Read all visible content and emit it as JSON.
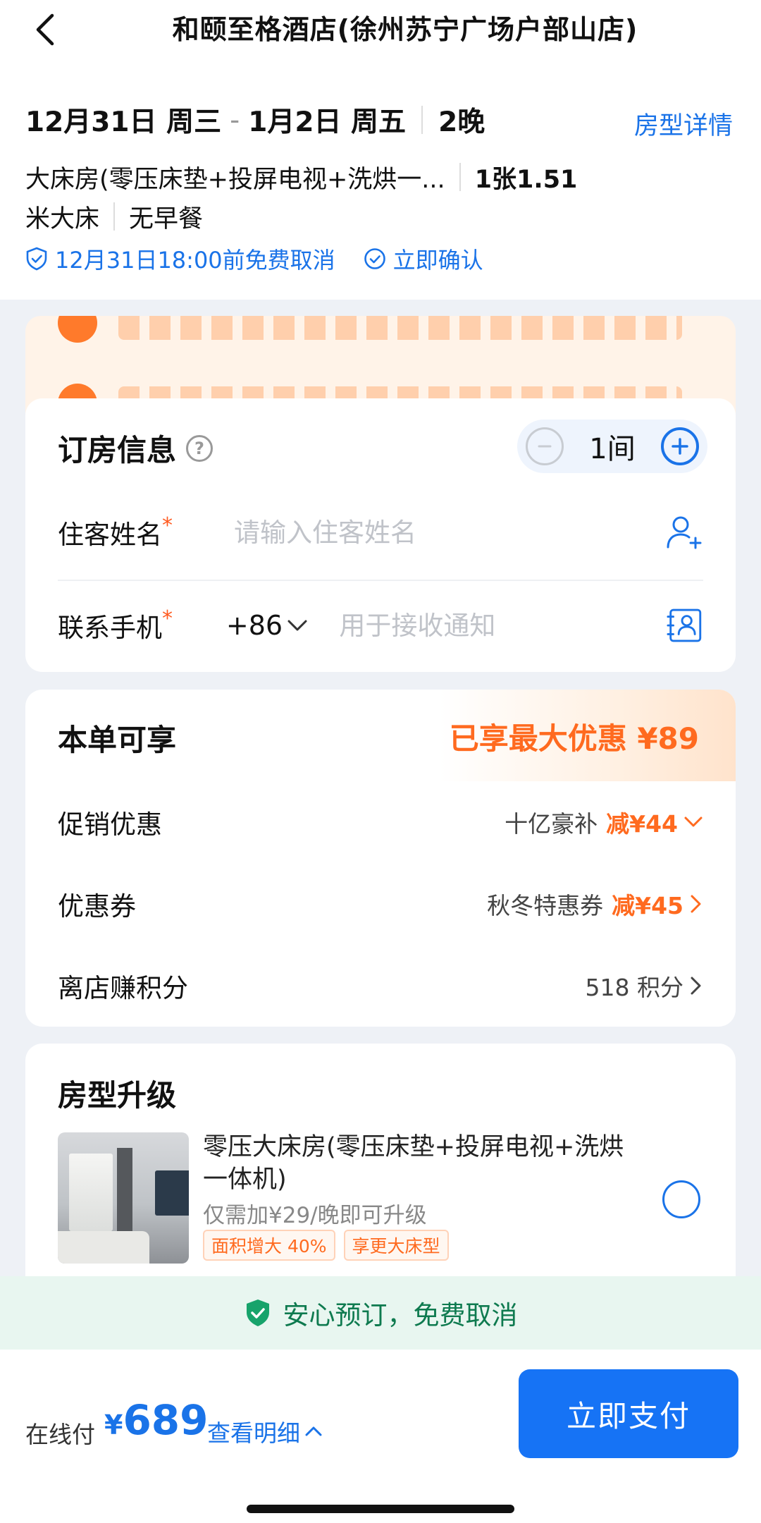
{
  "header": {
    "title": "和颐至格酒店(徐州苏宁广场户部山店)",
    "checkin": "12月31日 周三",
    "date_separator": "-",
    "checkout": "1月2日 周五",
    "nights": "2晚",
    "room_detail_link": "房型详情",
    "room_name": "大床房(零压床垫+投屏电视+洗烘一...",
    "bed_part1": "1张1.51",
    "bed_part2": "米大床",
    "breakfast": "无早餐",
    "cancel_policy": "12月31日18:00前免费取消",
    "instant_confirm": "立即确认"
  },
  "booking": {
    "title": "订房信息",
    "quantity": "1间",
    "guest_label": "住客姓名",
    "guest_placeholder": "请输入住客姓名",
    "phone_label": "联系手机",
    "country_code": "+86",
    "phone_placeholder": "用于接收通知",
    "required_mark": "*"
  },
  "discounts": {
    "title": "本单可享",
    "max_discount": "已享最大优惠 ¥89",
    "rows": [
      {
        "label": "促销优惠",
        "desc": "十亿豪补",
        "amount": "减¥44"
      },
      {
        "label": "优惠券",
        "desc": "秋冬特惠券",
        "amount": "减¥45"
      },
      {
        "label": "离店赚积分",
        "desc": "518 积分",
        "amount": ""
      }
    ]
  },
  "upgrade": {
    "title": "房型升级",
    "room_name": "零压大床房(零压床垫+投屏电视+洗烘一体机)",
    "price_note": "仅需加¥29/晚即可升级",
    "tags": [
      "面积增大 40%",
      "享更大床型"
    ]
  },
  "safe_banner": "安心预订，免费取消",
  "bottom": {
    "pay_label": "在线付",
    "currency": "¥",
    "price": "689",
    "detail_link": "查看明细",
    "pay_button": "立即支付"
  },
  "colors": {
    "accent": "#1a73e8",
    "discount": "#ff6a1f",
    "safe": "#0e7a4f"
  }
}
